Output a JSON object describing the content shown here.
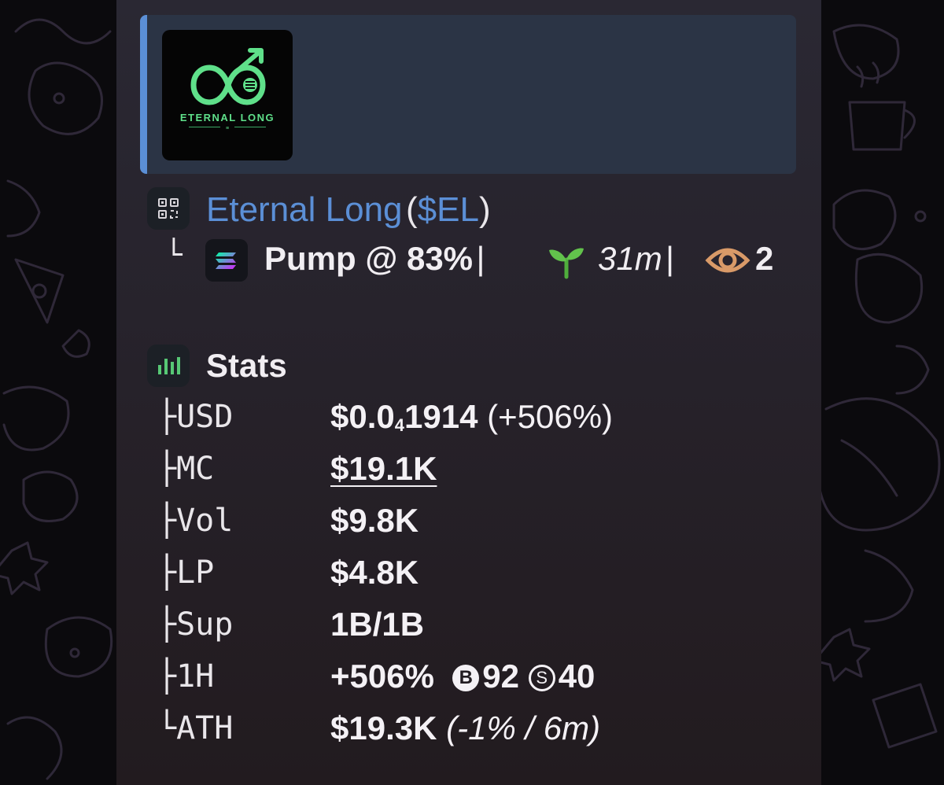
{
  "preview": {
    "logo_caption": "ETERNAL LONG",
    "logo_mark": "≡"
  },
  "token": {
    "name": "Eternal Long",
    "ticker_open": "(",
    "ticker": "$EL",
    "ticker_close": ")",
    "qr_icon": "qr-code-icon"
  },
  "subline": {
    "corner": "└",
    "chain_icon": "solana-icon",
    "pump_text": "Pump @ 83%",
    "sep1": "|",
    "age_icon": "sprout-icon",
    "age": "31m",
    "sep2": "|",
    "watch_icon": "eye-icon",
    "watchers": "2"
  },
  "stats": {
    "icon": "bar-chart-icon",
    "title": "Stats",
    "rows": [
      {
        "prefix": "├",
        "label": "USD",
        "value_main": "$0.0",
        "value_sub": "4",
        "value_rest": "1914",
        "value_extra": "(+506%)"
      },
      {
        "prefix": "├",
        "label": "MC",
        "value": "$19.1K"
      },
      {
        "prefix": "├",
        "label": "Vol",
        "value": "$9.8K"
      },
      {
        "prefix": "├",
        "label": "LP",
        "value": "$4.8K"
      },
      {
        "prefix": "├",
        "label": "Sup",
        "value": "1B/1B"
      },
      {
        "prefix": "├",
        "label": "1H",
        "value": "+506%",
        "buy_badge": "B",
        "buys": "92",
        "sell_badge": "S",
        "sells": "40"
      },
      {
        "prefix": "└",
        "label": "ATH",
        "value": "$19.3K",
        "value_extra": "(-1% / 6m)"
      }
    ]
  },
  "colors": {
    "accent": "#5b8fd6",
    "logo_green": "#5fe08a",
    "bubble": "#27232c",
    "preview_bg": "#2b3445"
  }
}
